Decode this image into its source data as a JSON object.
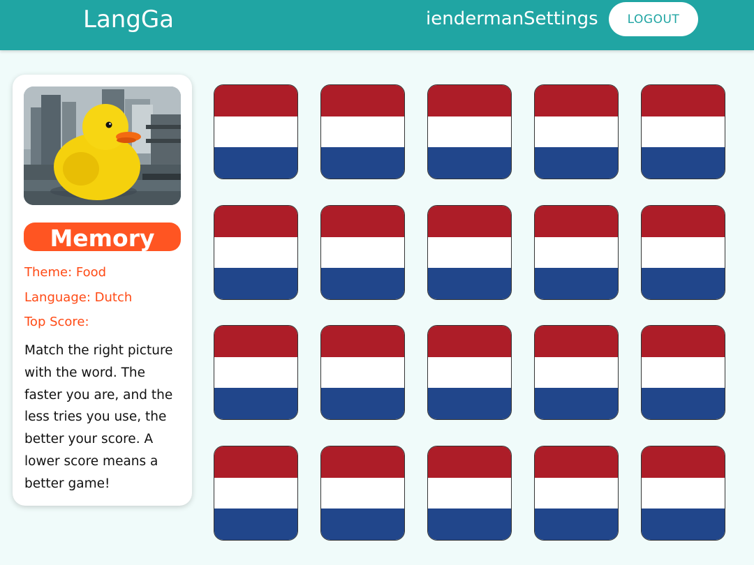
{
  "header": {
    "brand": "LangGa",
    "username": "ienderman",
    "settings_label": "Settings",
    "logout_label": "LOGOUT"
  },
  "sidebar": {
    "image_icon": "rubber-duck-photo",
    "game_title": "Memory",
    "theme": "Theme: Food",
    "language": "Language: Dutch",
    "top_score": "Top Score:",
    "description": "Match the right picture with the word. The faster you are, and the less tries you use, the better your score. A lower score means a better game!"
  },
  "board": {
    "card_back_icon": "netherlands-flag-icon",
    "rows": 4,
    "columns": 5,
    "flag_colors": [
      "#ad1d28",
      "#ffffff",
      "#21468b"
    ]
  },
  "colors": {
    "header": "#20a5a3",
    "accent": "#ff5522",
    "background": "#f0fbfa"
  }
}
